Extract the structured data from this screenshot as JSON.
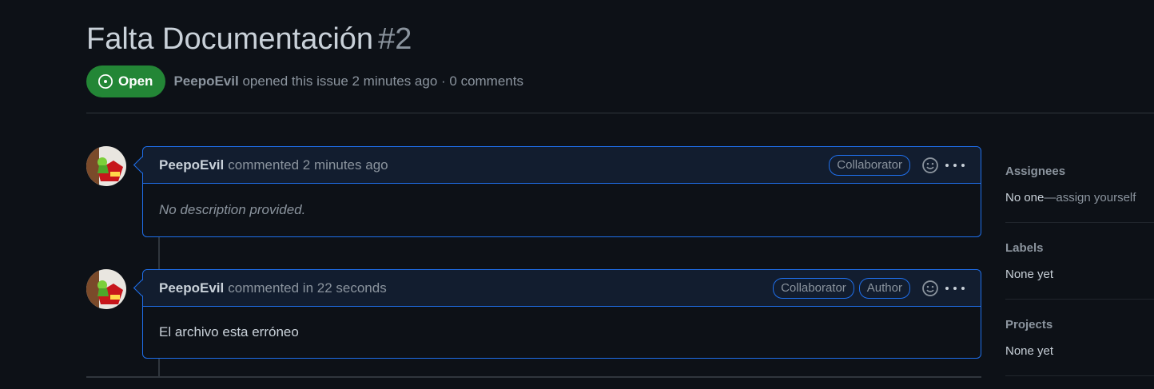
{
  "issue": {
    "title": "Falta Documentación",
    "number": "#2",
    "state": "Open",
    "author": "PeepoEvil",
    "meta_text": "opened this issue 2 minutes ago · 0 comments"
  },
  "comments": [
    {
      "author": "PeepoEvil",
      "action": "commented 2 minutes ago",
      "badges": [
        "Collaborator"
      ],
      "body": "No description provided."
    },
    {
      "author": "PeepoEvil",
      "action": "commented in 22 seconds",
      "badges": [
        "Collaborator",
        "Author"
      ],
      "body": "El archivo esta erróneo"
    }
  ],
  "sidebar": {
    "assignees": {
      "heading": "Assignees",
      "value": "No one",
      "link": "—assign yourself"
    },
    "labels": {
      "heading": "Labels",
      "value": "None yet"
    },
    "projects": {
      "heading": "Projects",
      "value": "None yet"
    }
  },
  "icons": {
    "state": "issue-opened-icon",
    "reaction": "smiley-icon",
    "menu": "kebab-horizontal-icon"
  },
  "colors": {
    "open_green": "#238636",
    "accent_blue": "#1f6feb",
    "background": "#0d1117"
  }
}
